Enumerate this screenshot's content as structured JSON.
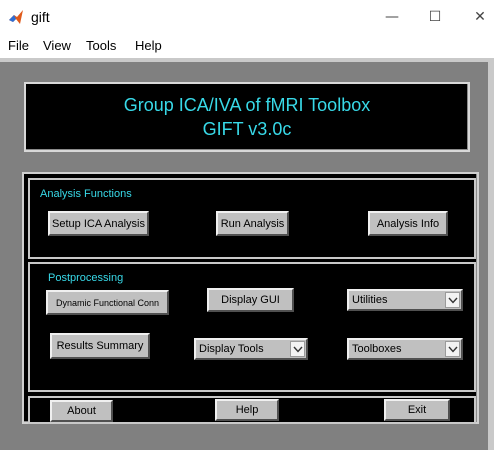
{
  "window": {
    "title": "gift",
    "minimize_glyph": "—",
    "maximize_glyph": "☐",
    "close_glyph": "✕",
    "app_icon": "matlab-icon"
  },
  "menubar": {
    "items": [
      "File",
      "View",
      "Tools",
      "Help"
    ]
  },
  "banner": {
    "line1": "Group ICA/IVA of fMRI Toolbox",
    "line2": "GIFT v3.0c"
  },
  "analysis": {
    "section_label": "Analysis Functions",
    "setup_button": "Setup ICA Analysis",
    "run_button": "Run Analysis",
    "info_button": "Analysis Info"
  },
  "postprocessing": {
    "section_label": "Postprocessing",
    "dfnc_button": "Dynamic Functional Conn",
    "display_gui_button": "Display GUI",
    "utilities_dropdown": "Utilities",
    "results_summary_button": "Results Summary",
    "display_tools_dropdown": "Display Tools",
    "toolboxes_dropdown": "Toolboxes"
  },
  "footer": {
    "about_button": "About",
    "help_button": "Help",
    "exit_button": "Exit"
  },
  "colors": {
    "accent_text": "#38d9e8",
    "panel_bg": "#000000",
    "figure_bg": "#808080",
    "button_bg": "#c0c0c0"
  }
}
